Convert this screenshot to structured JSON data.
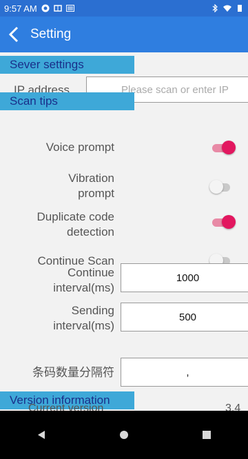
{
  "status_bar": {
    "time": "9:57 AM"
  },
  "app_bar": {
    "title": "Setting"
  },
  "sections": {
    "server": "Sever settings",
    "scan": "Scan tips",
    "version": "Version information"
  },
  "server": {
    "ip_label": "IP address",
    "ip_placeholder": "Please scan or enter IP",
    "ip_value": ""
  },
  "scan_tips": {
    "voice_label": "Voice prompt",
    "voice_on": true,
    "vibration_label_line1": "Vibration",
    "vibration_label_line2": "prompt",
    "vibration_on": false,
    "duplicate_label_line1": "Duplicate code",
    "duplicate_label_line2": "detection",
    "duplicate_on": true,
    "continue_label": "Continue Scan",
    "continue_on": false,
    "interval_label_line1": "Continue",
    "interval_label_line2": "interval(ms)",
    "interval_value": "1000",
    "sending_label_line1": "Sending",
    "sending_label_line2": "interval(ms)",
    "sending_value": "500",
    "separator_label": "条码数量分隔符",
    "separator_value": ","
  },
  "version": {
    "current_label": "Current version",
    "current_value": "3.4"
  },
  "colors": {
    "status_bar": "#2b6fd1",
    "app_bar": "#2f7ee0",
    "section_header": "#3ea8d8",
    "toggle_on": "#e2175f"
  }
}
